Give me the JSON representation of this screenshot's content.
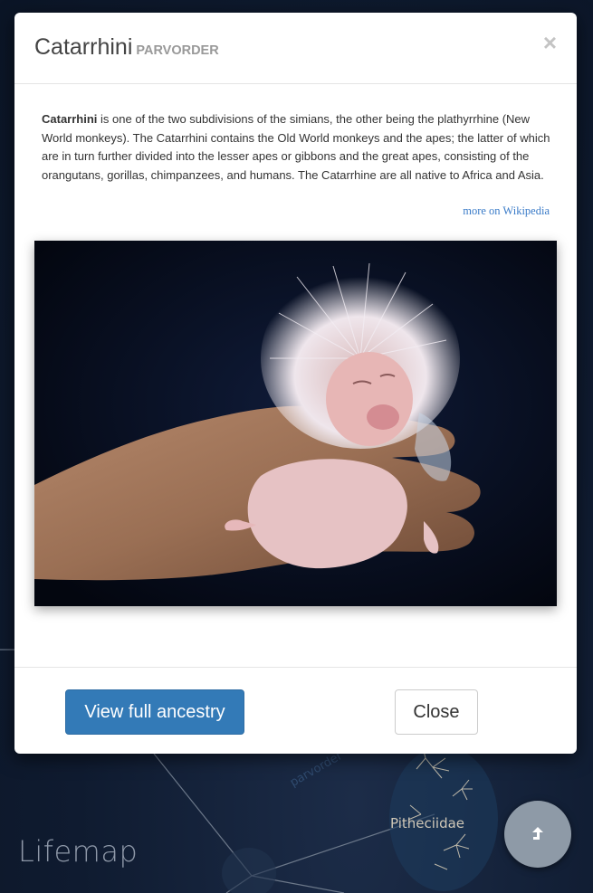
{
  "app": {
    "brand": "Lifemap",
    "visible_taxon_label": "Pitheciidae",
    "rank_watermark": "parvorder",
    "fab_icon": "share-arrow-icon"
  },
  "modal": {
    "title": "Catarrhini",
    "subtitle": "PARVORDER",
    "close_icon": "×",
    "description": {
      "term": "Catarrhini",
      "text": " is one of the two subdivisions of the simians, the other being the plathyrrhine (New World monkeys). The Catarrhini contains the Old World monkeys and the apes; the latter of which are in turn further divided into the lesser apes or gibbons and the great apes, consisting of the orangutans, gorillas, chimpanzees, and humans. The Catarrhine are all native to Africa and Asia."
    },
    "wiki_link": "more on Wikipedia",
    "image_subject": "baby-primate-photo",
    "footer": {
      "primary_button": "View full ancestry",
      "close_button": "Close"
    }
  },
  "colors": {
    "primary": "#337ab7",
    "link": "#3a7bc8",
    "background": "#0e1a2e"
  }
}
